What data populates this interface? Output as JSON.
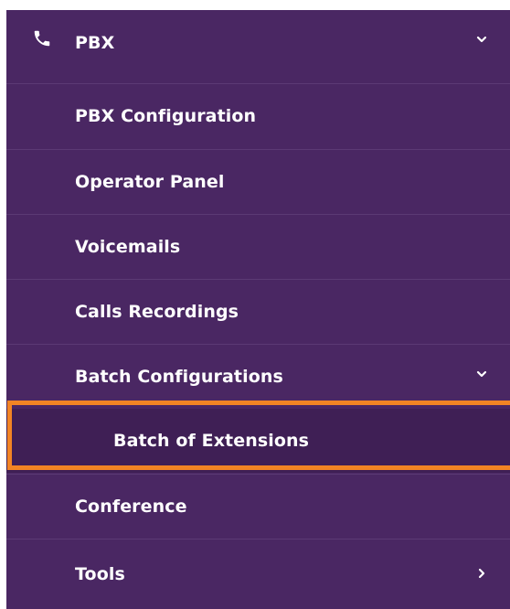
{
  "menu": {
    "header": {
      "label": "PBX",
      "icon": "phone-icon",
      "expanded": true
    },
    "items": [
      {
        "label": "PBX Configuration"
      },
      {
        "label": "Operator Panel"
      },
      {
        "label": "Voicemails"
      },
      {
        "label": "Calls Recordings"
      },
      {
        "label": "Batch Configurations",
        "expanded": true
      },
      {
        "label": "Batch of Extensions",
        "active": true
      },
      {
        "label": "Conference"
      },
      {
        "label": "Tools",
        "collapsed": true
      }
    ]
  },
  "colors": {
    "menu_bg": "#4a2763",
    "active_bg": "#3f1f55",
    "highlight": "#f28424",
    "text": "#ffffff"
  }
}
